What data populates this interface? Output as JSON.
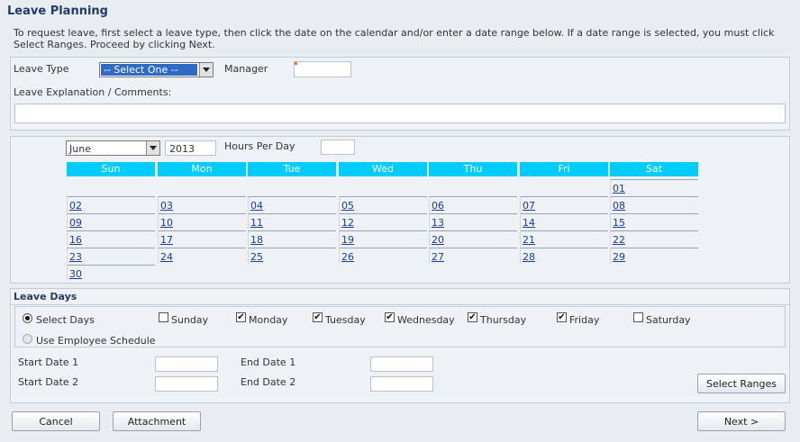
{
  "title": "Leave Planning",
  "instructions": "To request leave, first select a leave type, then click the date on the calendar and/or enter a date range below. If a date range is selected, you must click Select Ranges. Proceed by clicking Next.",
  "form": {
    "leave_type_label": "Leave Type",
    "leave_type_value": "-- Select One --",
    "manager_label": "Manager",
    "manager_value": "",
    "comments_label": "Leave Explanation / Comments:",
    "comments_value": ""
  },
  "calendar": {
    "month": "June",
    "year": "2013",
    "hours_label": "Hours Per Day",
    "hours_value": "",
    "days_header": [
      "Sun",
      "Mon",
      "Tue",
      "Wed",
      "Thu",
      "Fri",
      "Sat"
    ],
    "weeks": [
      [
        "",
        "",
        "",
        "",
        "",
        "",
        "01"
      ],
      [
        "02",
        "03",
        "04",
        "05",
        "06",
        "07",
        "08"
      ],
      [
        "09",
        "10",
        "11",
        "12",
        "13",
        "14",
        "15"
      ],
      [
        "16",
        "17",
        "18",
        "19",
        "20",
        "21",
        "22"
      ],
      [
        "23",
        "24",
        "25",
        "26",
        "27",
        "28",
        "29"
      ],
      [
        "30",
        "",
        "",
        "",
        "",
        "",
        ""
      ]
    ]
  },
  "leave_days": {
    "title": "Leave Days",
    "select_days_label": "Select Days",
    "use_schedule_label": "Use Employee Schedule",
    "days": [
      {
        "label": "Sunday",
        "checked": false
      },
      {
        "label": "Monday",
        "checked": true
      },
      {
        "label": "Tuesday",
        "checked": true
      },
      {
        "label": "Wednesday",
        "checked": true
      },
      {
        "label": "Thursday",
        "checked": true
      },
      {
        "label": "Friday",
        "checked": true
      },
      {
        "label": "Saturday",
        "checked": false
      }
    ]
  },
  "ranges": {
    "start1_label": "Start Date 1",
    "end1_label": "End Date 1",
    "start2_label": "Start Date 2",
    "end2_label": "End Date 2",
    "start1_value": "",
    "end1_value": "",
    "start2_value": "",
    "end2_value": "",
    "select_ranges_label": "Select Ranges"
  },
  "buttons": {
    "cancel": "Cancel",
    "attachment": "Attachment",
    "next": "Next >"
  },
  "colors": {
    "calendar_header": "#00ccff",
    "title": "#1f3d6b",
    "link": "#1a3c9c"
  }
}
